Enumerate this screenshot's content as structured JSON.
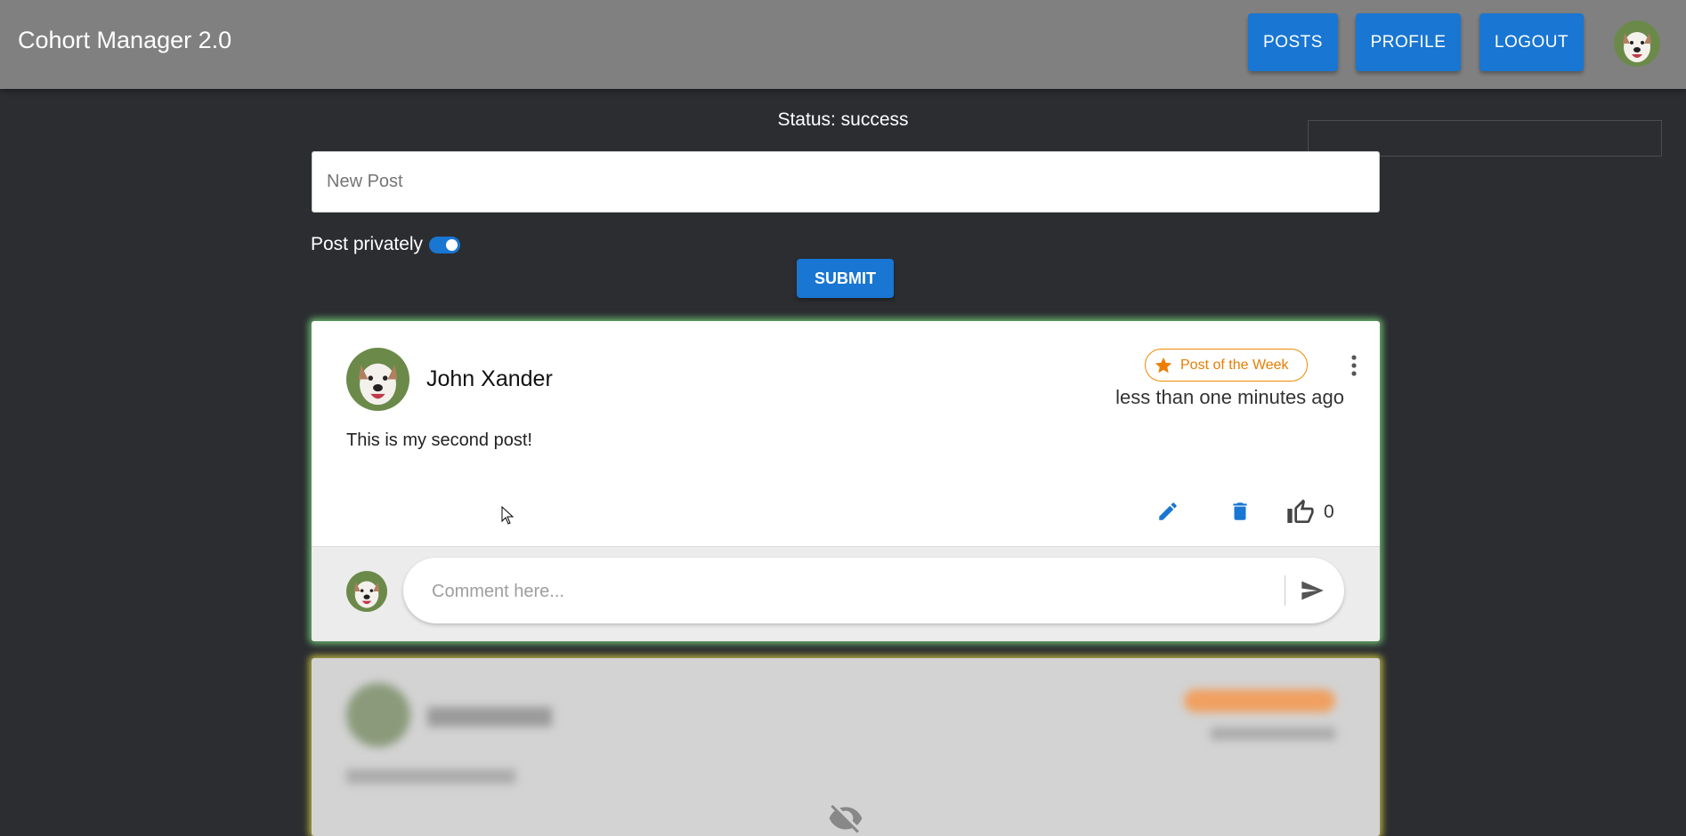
{
  "app": {
    "title": "Cohort Manager 2.0"
  },
  "nav": {
    "posts_label": "POSTS",
    "profile_label": "PROFILE",
    "logout_label": "LOGOUT",
    "avatar_icon": "dog-avatar-icon"
  },
  "status": {
    "text": "Status: success"
  },
  "composer": {
    "placeholder": "New Post",
    "value": "",
    "private_label": "Post privately",
    "private_enabled": true,
    "submit_label": "SUBMIT"
  },
  "post": {
    "author": "John Xander",
    "badge": "Post of the Week",
    "time": "less than one minutes ago",
    "body": "This is my second post!",
    "likes": "0",
    "comment_placeholder": "Comment here...",
    "icons": [
      "star-icon",
      "more-vert-icon",
      "edit-icon",
      "delete-icon",
      "thumb-up-icon",
      "send-icon"
    ]
  },
  "colors": {
    "appbar": "#808080",
    "background": "#2b2d31",
    "accent": "#1976d2",
    "badge": "#ef8a00",
    "card_glow": "#82e682",
    "next_card_glow": "#d7d246"
  }
}
